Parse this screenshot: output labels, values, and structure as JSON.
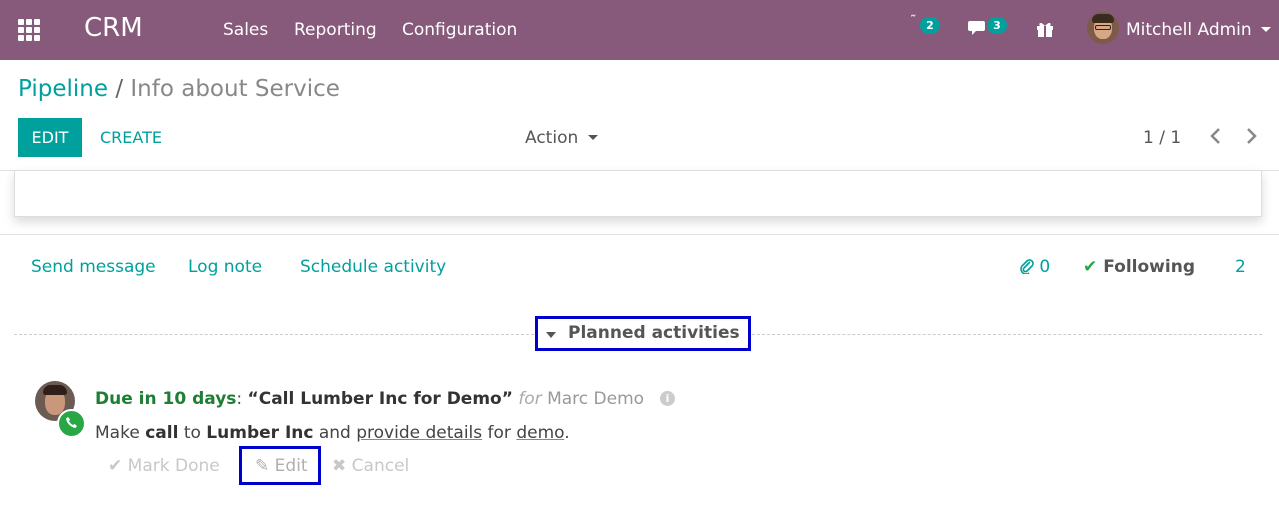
{
  "navbar": {
    "app_name": "CRM",
    "menu": [
      "Sales",
      "Reporting",
      "Configuration"
    ],
    "activity_count": "2",
    "message_count": "3",
    "user_name": "Mitchell Admin",
    "bg_color": "#875a7b",
    "icons": [
      "apps-grid-icon",
      "clock-icon",
      "chat-icon",
      "gift-icon"
    ]
  },
  "breadcrumb": {
    "parent": "Pipeline",
    "separator": "/",
    "current": "Info about Service"
  },
  "controls": {
    "edit_label": "EDIT",
    "create_label": "CREATE",
    "action_label": "Action",
    "pager": "1 / 1"
  },
  "chatter": {
    "send_message": "Send message",
    "log_note": "Log note",
    "schedule_activity": "Schedule activity",
    "attachments": "0",
    "following": "Following",
    "followers": "2",
    "planned_activities": "Planned activities"
  },
  "activity": {
    "due": "Due in 10 days",
    "colon": ":",
    "summary": "“Call Lumber Inc for Demo”",
    "for_label": "for",
    "assignee": "Marc Demo",
    "note_make": "Make",
    "note_call": "call",
    "note_to": "to",
    "note_company": "Lumber Inc",
    "note_and": "and",
    "note_provide": "provide details",
    "note_for": "for",
    "note_demo": "demo",
    "note_end": ".",
    "mark_done": "Mark Done",
    "edit": "Edit",
    "cancel": "Cancel"
  }
}
